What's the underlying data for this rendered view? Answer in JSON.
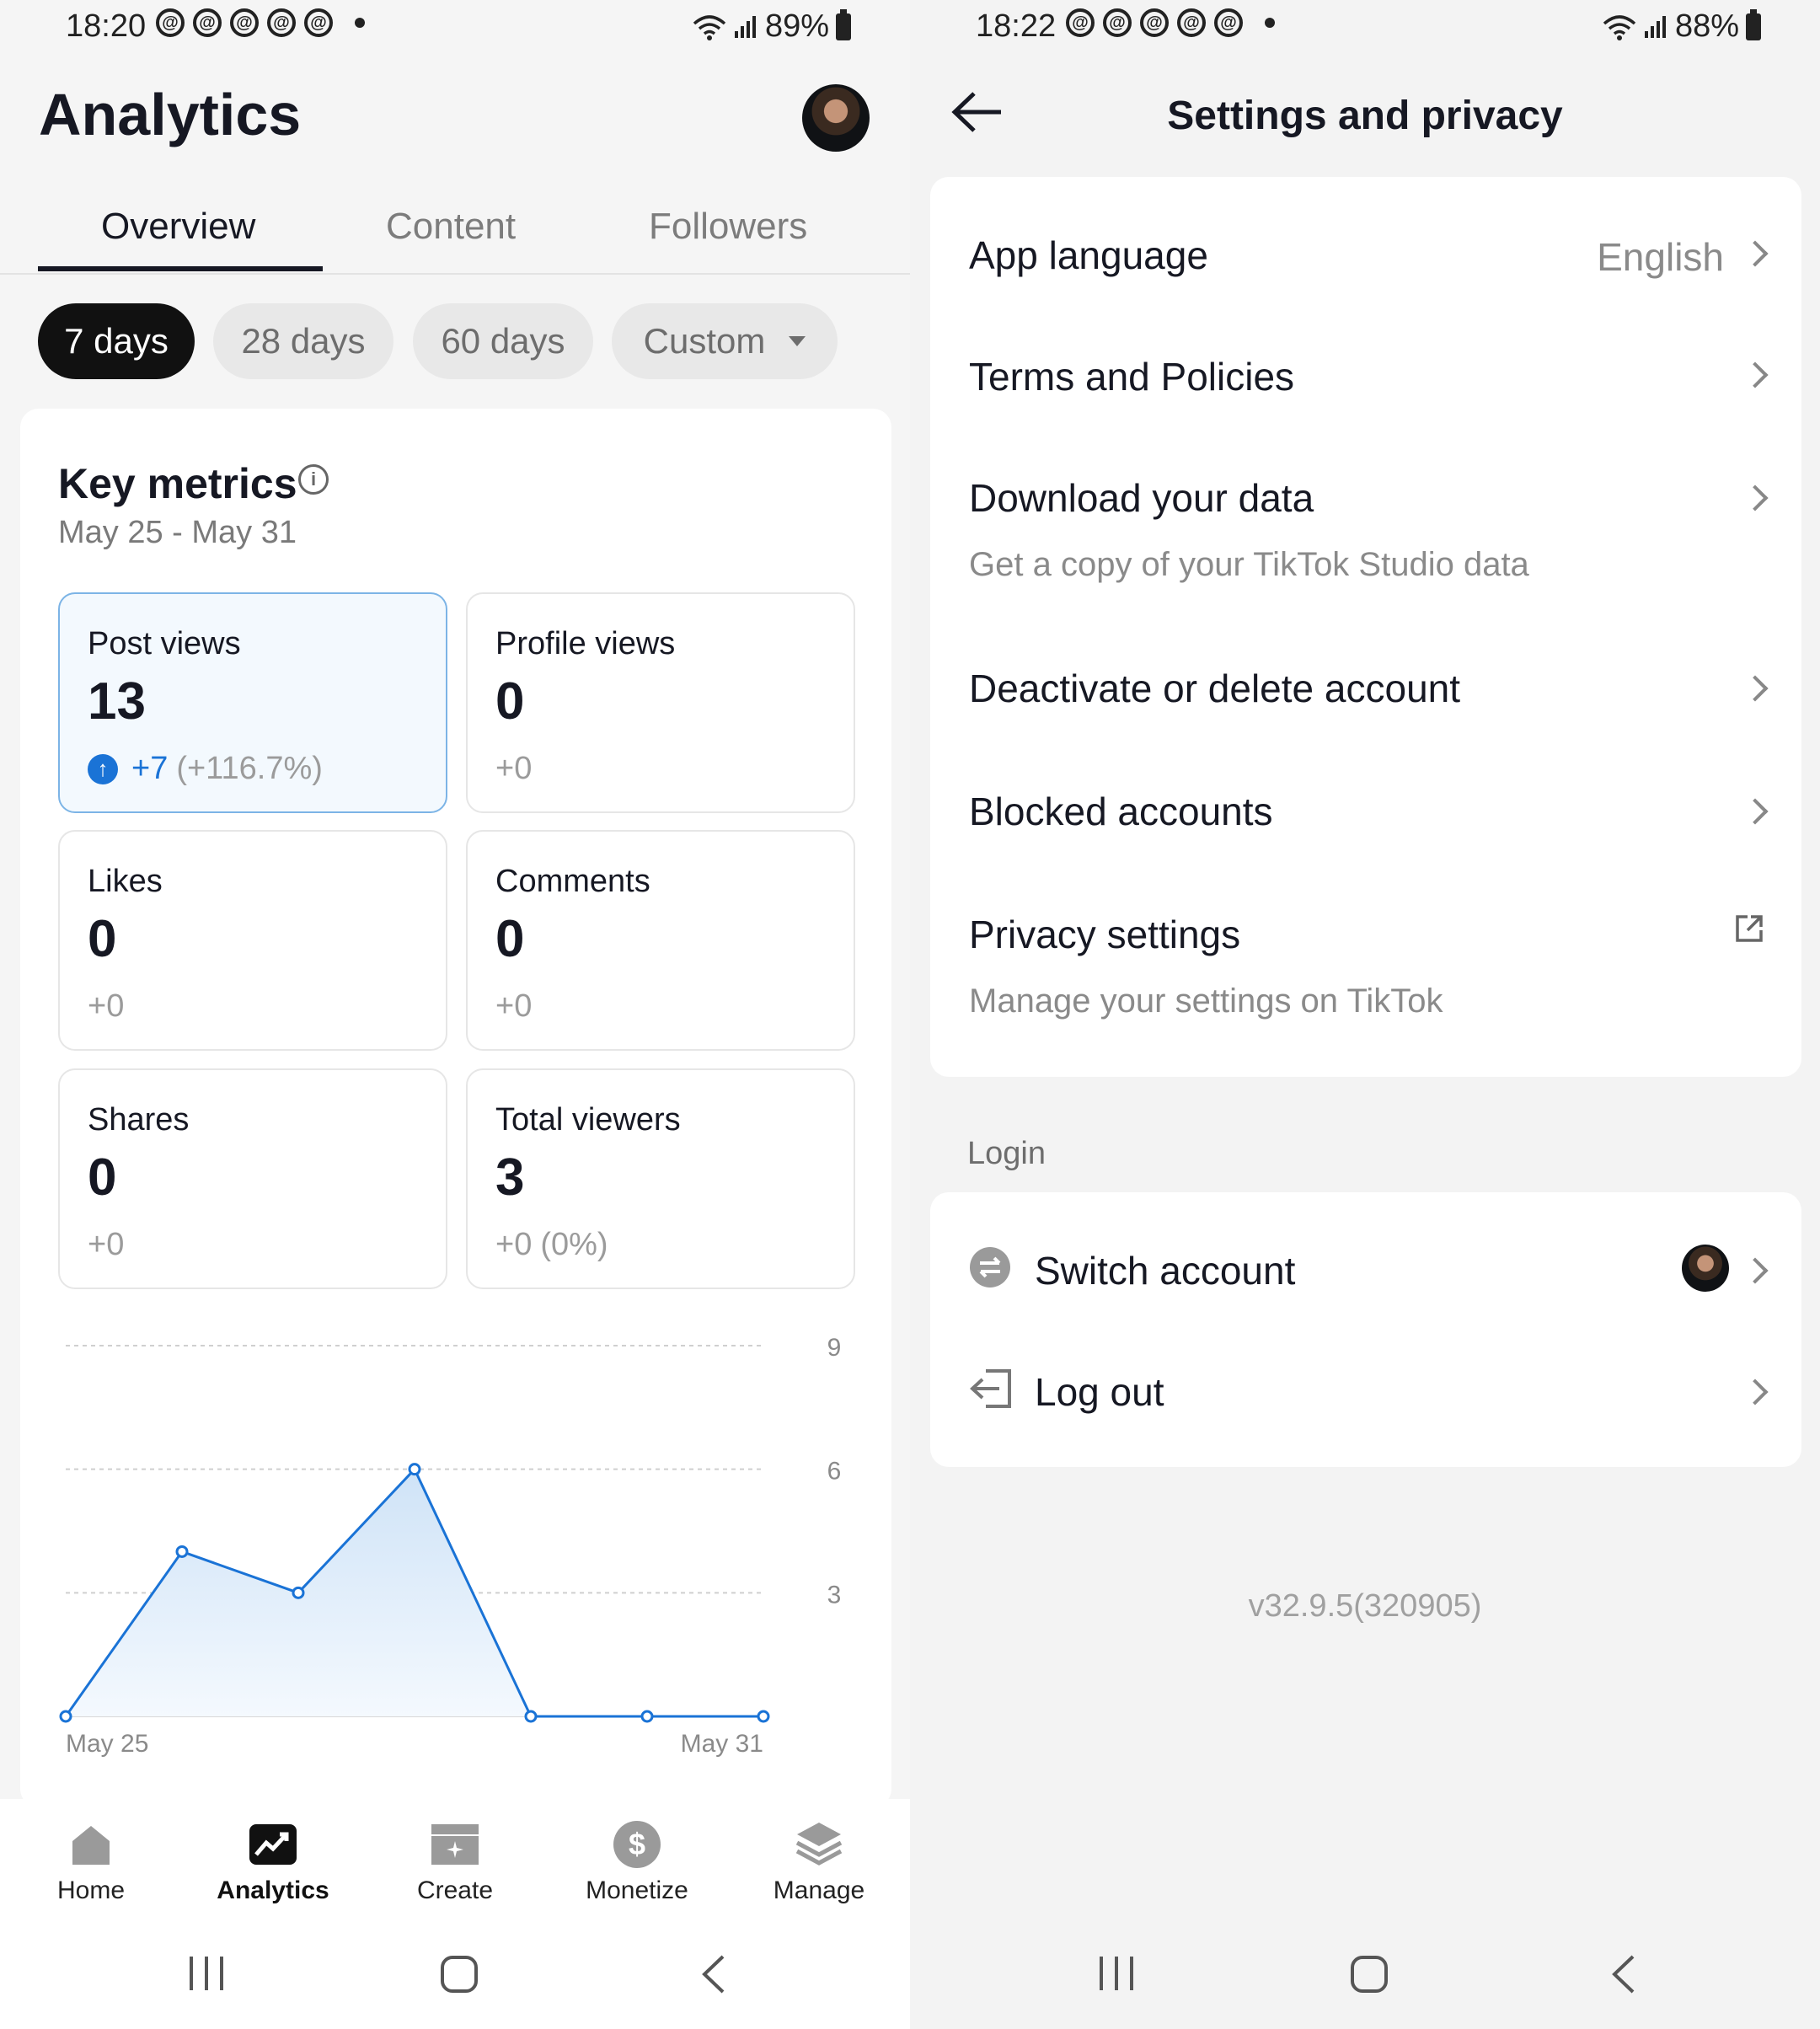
{
  "left_screen": {
    "status": {
      "time": "18:20",
      "battery": "89%"
    },
    "title": "Analytics",
    "tabs": [
      "Overview",
      "Content",
      "Followers"
    ],
    "periods": [
      "7 days",
      "28 days",
      "60 days",
      "Custom"
    ],
    "key_metrics": {
      "title": "Key metrics",
      "range": "May 25 - May 31",
      "cards": [
        {
          "label": "Post views",
          "value": "13",
          "delta": "+7",
          "delta_pct": "(+116.7%)"
        },
        {
          "label": "Profile views",
          "value": "0",
          "delta": "+0",
          "delta_pct": ""
        },
        {
          "label": "Likes",
          "value": "0",
          "delta": "+0",
          "delta_pct": ""
        },
        {
          "label": "Comments",
          "value": "0",
          "delta": "+0",
          "delta_pct": ""
        },
        {
          "label": "Shares",
          "value": "0",
          "delta": "+0",
          "delta_pct": ""
        },
        {
          "label": "Total viewers",
          "value": "3",
          "delta": "+0",
          "delta_pct": "(0%)"
        }
      ]
    },
    "chart_data": {
      "type": "area",
      "x_labels": [
        "May 25",
        "May 31"
      ],
      "values": [
        0,
        4,
        3,
        6,
        0,
        0,
        0
      ],
      "y_ticks": [
        3,
        6,
        9
      ],
      "ylim": [
        0,
        9
      ],
      "color": "#1a73d6"
    },
    "nav": [
      {
        "label": "Home",
        "icon": "home-icon"
      },
      {
        "label": "Analytics",
        "icon": "analytics-icon"
      },
      {
        "label": "Create",
        "icon": "create-icon"
      },
      {
        "label": "Monetize",
        "icon": "dollar-icon"
      },
      {
        "label": "Manage",
        "icon": "layers-icon"
      }
    ]
  },
  "right_screen": {
    "status": {
      "time": "18:22",
      "battery": "88%"
    },
    "title": "Settings and privacy",
    "items": [
      {
        "label": "App language",
        "value": "English"
      },
      {
        "label": "Terms and Policies"
      },
      {
        "label": "Download your data",
        "sub": "Get a copy of your TikTok Studio data"
      },
      {
        "label": "Deactivate or delete account"
      },
      {
        "label": "Blocked accounts"
      },
      {
        "label": "Privacy settings",
        "sub": "Manage your settings on TikTok"
      }
    ],
    "login_section": "Login",
    "login_items": [
      {
        "label": "Switch account",
        "icon": "switch-icon"
      },
      {
        "label": "Log out",
        "icon": "logout-icon"
      }
    ],
    "version": "v32.9.5(320905)"
  }
}
